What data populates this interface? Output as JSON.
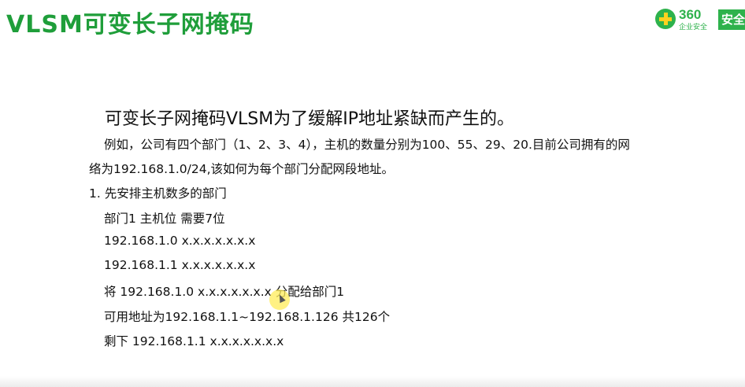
{
  "slide": {
    "title": "VLSM可变长子网掩码",
    "brand": {
      "number": "360",
      "subtitle": "企业安全",
      "box_text": "安全"
    },
    "heading": "可变长子网掩码VLSM为了缓解IP地址紧缺而产生的。",
    "intro_line1": "例如，公司有四个部门（1、2、3、4），主机的数量分别为100、55、29、20.目前公司拥有的网",
    "intro_line2": "络为192.168.1.0/24,该如何为每个部门分配网段地址。",
    "step1": "1.  先安排主机数多的部门",
    "lines": [
      "部门1 主机位 需要7位",
      "192.168.1.0 x.x.x.x.x.x.x",
      "192.168.1.1 x.x.x.x.x.x.x",
      "将 192.168.1.0 x.x.x.x.x.x.x 分配给部门1",
      "可用地址为192.168.1.1~192.168.1.126 共126个",
      "剩下 192.168.1.1 x.x.x.x.x.x.x"
    ]
  },
  "colors": {
    "title_green": "#1f9e3a",
    "brand_green": "#2eb24c",
    "brand_yellow": "#ffd21f",
    "cursor_highlight": "#ffec5a"
  }
}
